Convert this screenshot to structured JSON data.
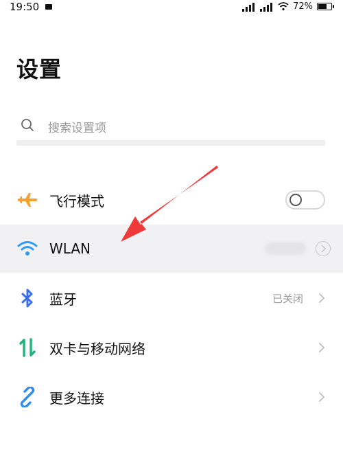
{
  "status_bar": {
    "time": "19:50",
    "battery_percent": "72%",
    "battery_level": 0.72
  },
  "page": {
    "title": "设置"
  },
  "search": {
    "placeholder": "搜索设置项"
  },
  "settings": [
    {
      "id": "airplane",
      "label": "飞行模式",
      "icon": "airplane-icon",
      "icon_color": "#f5a030",
      "control": "toggle",
      "toggle_on": false
    },
    {
      "id": "wlan",
      "label": "WLAN",
      "icon": "wifi-icon",
      "icon_color": "#2e9cf5",
      "control": "chevron",
      "highlighted": true
    },
    {
      "id": "bluetooth",
      "label": "蓝牙",
      "icon": "bluetooth-icon",
      "icon_color": "#3b6ee8",
      "value": "已关闭",
      "control": "chevron"
    },
    {
      "id": "sim",
      "label": "双卡与移动网络",
      "icon": "sim-network-icon",
      "icon_color": "#1fb57a",
      "control": "chevron"
    },
    {
      "id": "more",
      "label": "更多连接",
      "icon": "link-icon",
      "icon_color": "#2e8ef0",
      "control": "chevron"
    }
  ],
  "annotation": {
    "arrow_color": "#f03a3a",
    "points_to": "wlan"
  }
}
